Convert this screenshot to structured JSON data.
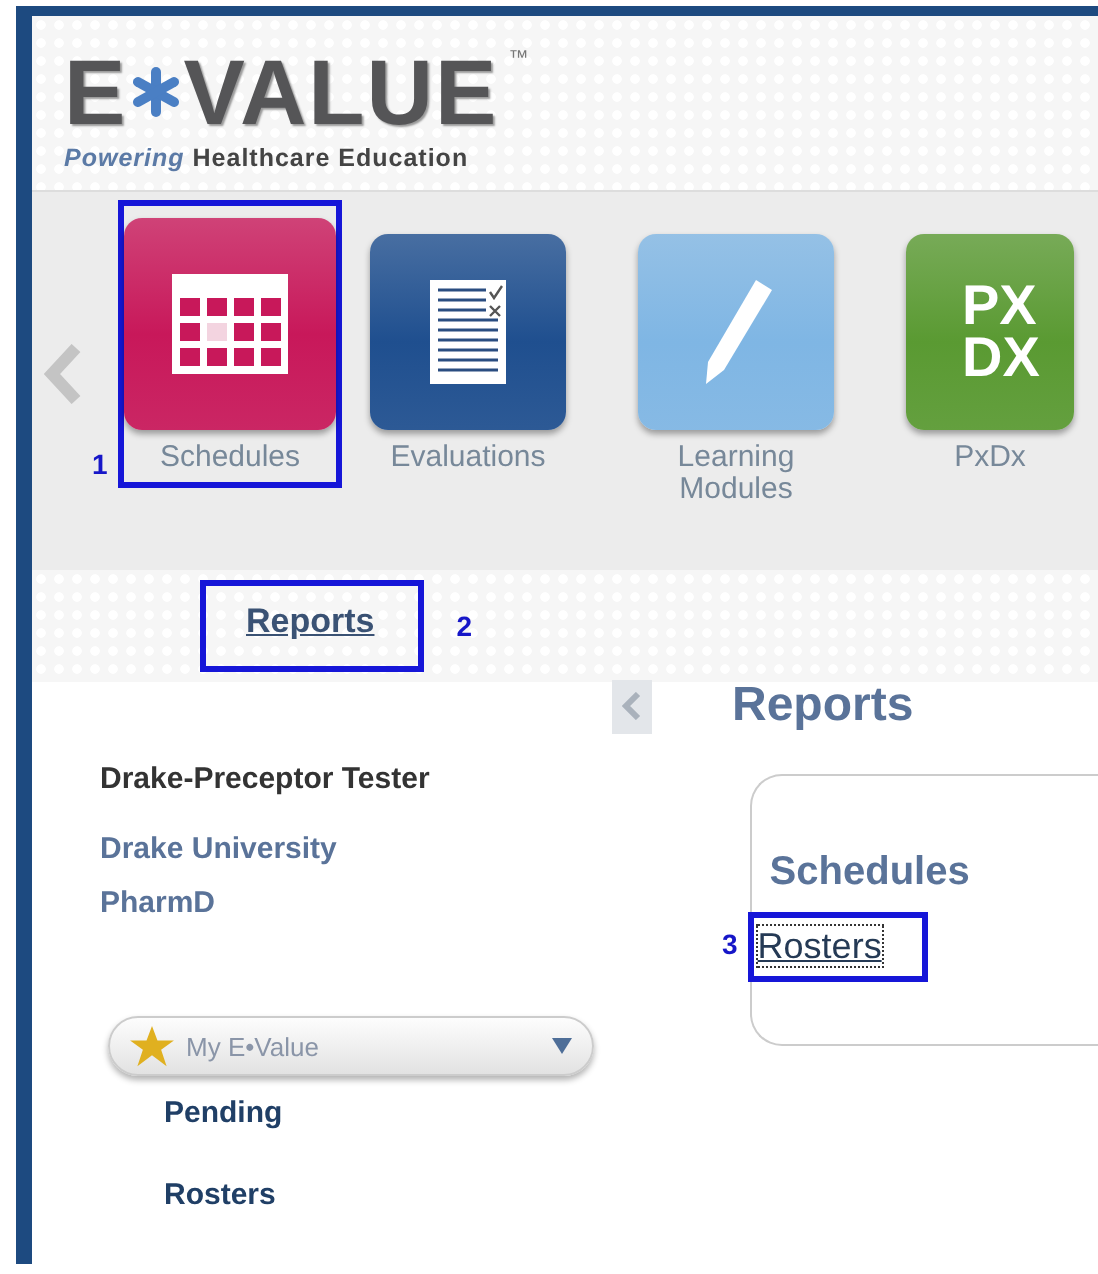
{
  "logo": {
    "first": "E",
    "rest": "VALUE",
    "tm": "™",
    "tagline_lead": "Powering",
    "tagline": "Healthcare Education"
  },
  "modules": [
    {
      "kind": "calendar",
      "label": "Schedules",
      "color": "#c8185a",
      "callout": "1"
    },
    {
      "kind": "document",
      "label": "Evaluations",
      "color": "#1f4f8f"
    },
    {
      "kind": "pencil",
      "label": "Learning Modules",
      "color": "#7fb6e4"
    },
    {
      "kind": "letters",
      "label": "PxDx",
      "color": "#5a9a32",
      "icon_text": [
        "PX",
        "DX"
      ]
    }
  ],
  "breadcrumb": {
    "label": "Reports",
    "callout": "2"
  },
  "user": {
    "name": "Drake-Preceptor Tester",
    "institution": "Drake University",
    "program": "PharmD"
  },
  "menu": {
    "label": "My E•Value",
    "items": [
      "Pending",
      "Rosters"
    ]
  },
  "content": {
    "title": "Reports",
    "section": "Schedules",
    "link": "Rosters",
    "callout": "3"
  }
}
